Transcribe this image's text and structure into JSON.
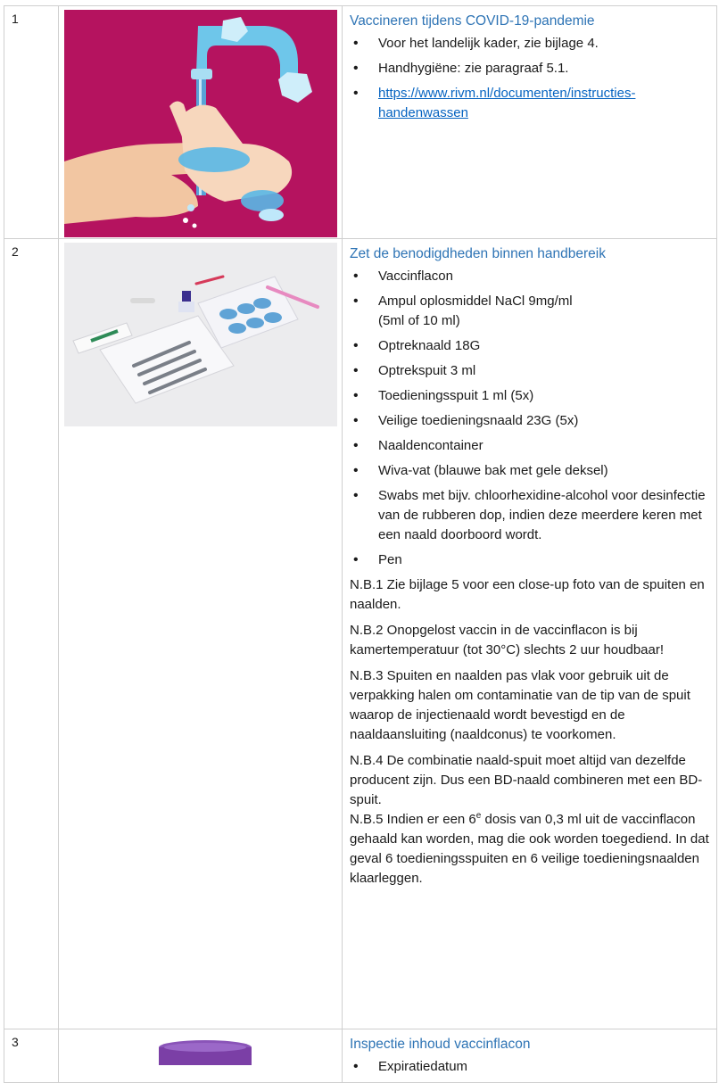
{
  "rows": [
    {
      "number": "1",
      "image_icon": "handwashing-illustration",
      "title": "Vaccineren tijdens COVID-19-pandemie",
      "bullets": [
        "Voor het landelijk kader, zie bijlage 4.",
        "Handhygiëne: zie paragraaf 5.1."
      ],
      "link": "https://www.rivm.nl/documenten/instructies-handenwassen"
    },
    {
      "number": "2",
      "image_icon": "supplies-photo",
      "title": "Zet de benodigdheden binnen handbereik",
      "bullets": [
        "Vaccinflacon",
        "Ampul oplosmiddel NaCl  9mg/ml",
        "Optreknaald 18G",
        "Optrekspuit 3 ml",
        "Toedieningsspuit 1 ml (5x)",
        "Veilige toedieningsnaald 23G (5x)",
        "Naaldencontainer",
        "Wiva-vat (blauwe bak met gele deksel)",
        "Swabs met bijv. chloorhexidine-alcohol voor desinfectie van de rubberen dop, indien deze meerdere keren met een naald doorboord wordt.",
        "Pen"
      ],
      "bullet_sub": "(5ml of 10 ml)",
      "notes": [
        "N.B.1 Zie bijlage 5 voor een close-up foto van de spuiten en naalden.",
        "N.B.2 Onopgelost vaccin in de vaccinflacon is bij kamertemperatuur (tot 30°C) slechts 2 uur houdbaar!",
        "N.B.3 Spuiten en naalden pas vlak voor gebruik uit de verpakking halen om contaminatie van de tip van de spuit waarop de injectienaald wordt bevestigd en de naaldaansluiting (naaldconus) te voorkomen.",
        "N.B.4  De combinatie naald-spuit moet altijd van dezelfde producent zijn. Dus een BD-naald combineren met een BD-spuit."
      ],
      "note5_pre": "N.B.5 Indien er een 6",
      "note5_sup": "e",
      "note5_post": " dosis van 0,3 ml uit de vaccinflacon gehaald kan worden, mag die ook worden toegediend. In dat geval 6 toedieningsspuiten en 6 veilige toedieningsnaalden klaarleggen."
    },
    {
      "number": "3",
      "image_icon": "vial-cap-photo",
      "title": "Inspectie inhoud vaccinflacon",
      "bullets": [
        "Expiratiedatum"
      ]
    }
  ],
  "colors": {
    "title": "#2e74b5",
    "link": "#0563c1",
    "illustration_bg": "#b5135f",
    "vial_cap": "#7b3fa6"
  }
}
